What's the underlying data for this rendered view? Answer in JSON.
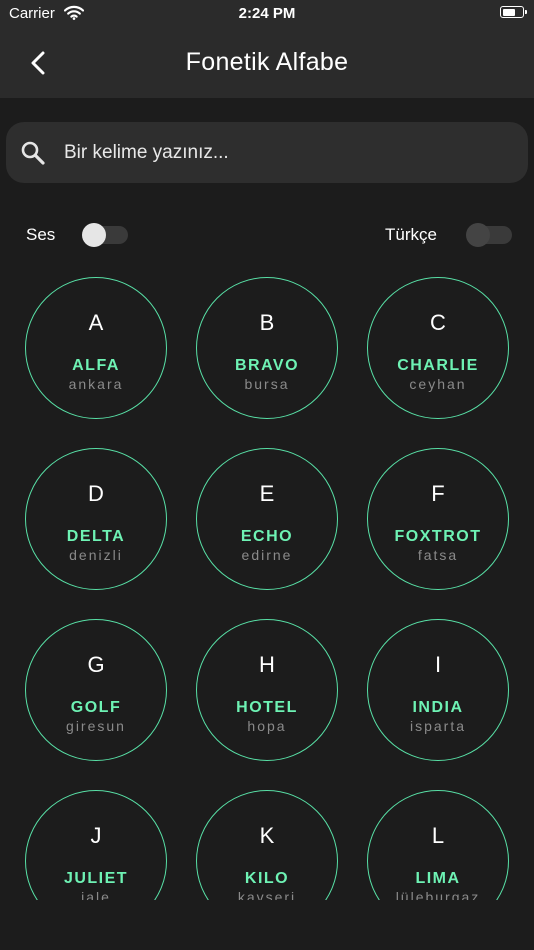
{
  "status_bar": {
    "carrier": "Carrier",
    "time": "2:24 PM",
    "battery_level": 0.55
  },
  "nav": {
    "title": "Fonetik Alfabe",
    "back_icon": "chevron-left-icon"
  },
  "search": {
    "placeholder": "Bir kelime yazınız...",
    "value": "",
    "icon": "search-icon"
  },
  "toggles": {
    "ses": {
      "label": "Ses",
      "on": false
    },
    "turkce": {
      "label": "Türkçe",
      "on": false
    }
  },
  "colors": {
    "accent": "#6ef2b4",
    "border": "#58e0a6",
    "background": "#1c1c1c",
    "bar": "#2b2b2b"
  },
  "letters": [
    {
      "letter": "A",
      "code": "ALFA",
      "city": "ankara"
    },
    {
      "letter": "B",
      "code": "BRAVO",
      "city": "bursa"
    },
    {
      "letter": "C",
      "code": "CHARLIE",
      "city": "ceyhan"
    },
    {
      "letter": "D",
      "code": "DELTA",
      "city": "denizli"
    },
    {
      "letter": "E",
      "code": "ECHO",
      "city": "edirne"
    },
    {
      "letter": "F",
      "code": "FOXTROT",
      "city": "fatsa"
    },
    {
      "letter": "G",
      "code": "GOLF",
      "city": "giresun"
    },
    {
      "letter": "H",
      "code": "HOTEL",
      "city": "hopa"
    },
    {
      "letter": "I",
      "code": "INDIA",
      "city": "isparta"
    },
    {
      "letter": "J",
      "code": "JULIET",
      "city": "iale"
    },
    {
      "letter": "K",
      "code": "KILO",
      "city": "kavseri"
    },
    {
      "letter": "L",
      "code": "LIMA",
      "city": "lüleburgaz"
    }
  ]
}
